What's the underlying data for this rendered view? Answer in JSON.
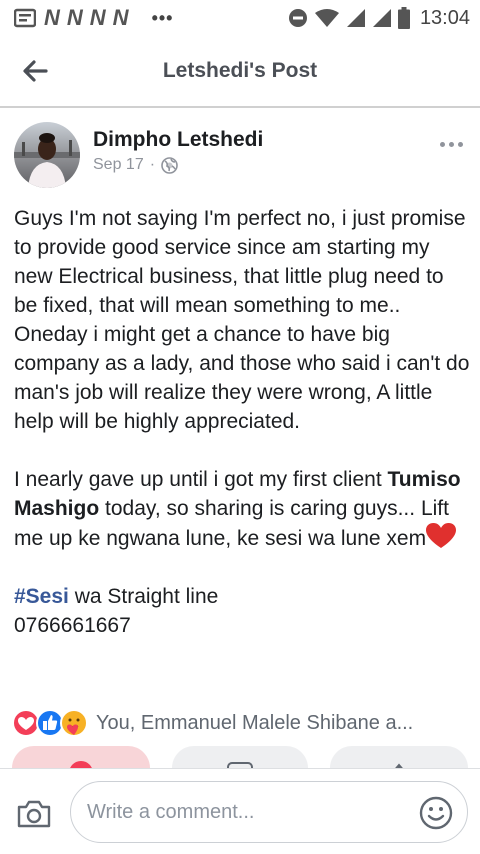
{
  "status_bar": {
    "notification_glyphs": [
      "N",
      "N",
      "N",
      "N"
    ],
    "more_dots": "•••",
    "time": "13:04"
  },
  "header": {
    "title": "Letshedi's Post"
  },
  "post": {
    "author": "Dimpho Letshedi",
    "date": "Sep 17",
    "separator": "·",
    "paragraph1": "Guys I'm not saying I'm perfect no, i just promise to provide good service since am starting my new Electrical business, that little plug need to be fixed, that will mean something to me.. Oneday i might get a chance to have big company as a lady, and those who said i can't do man's job will realize they were wrong, A little help will be highly appreciated.",
    "p2_before": "I nearly gave up until i got my first client ",
    "p2_mention": "Tumiso Mashigo",
    "p2_after": " today, so sharing is caring guys... Lift me up ke ngwana lune, ke sesi wa lune xem",
    "p2_emoji": "❤️",
    "hashtag": "#Sesi",
    "hashtag_after": " wa Straight line",
    "phone": "0766661667"
  },
  "reactions": {
    "summary": "You, Emmanuel Malele Shibane a..."
  },
  "comment_bar": {
    "placeholder": "Write a comment..."
  },
  "colors": {
    "link_blue": "#385898",
    "love_red": "#f33e58",
    "like_blue": "#1877f2",
    "meta_grey": "#90949c"
  }
}
